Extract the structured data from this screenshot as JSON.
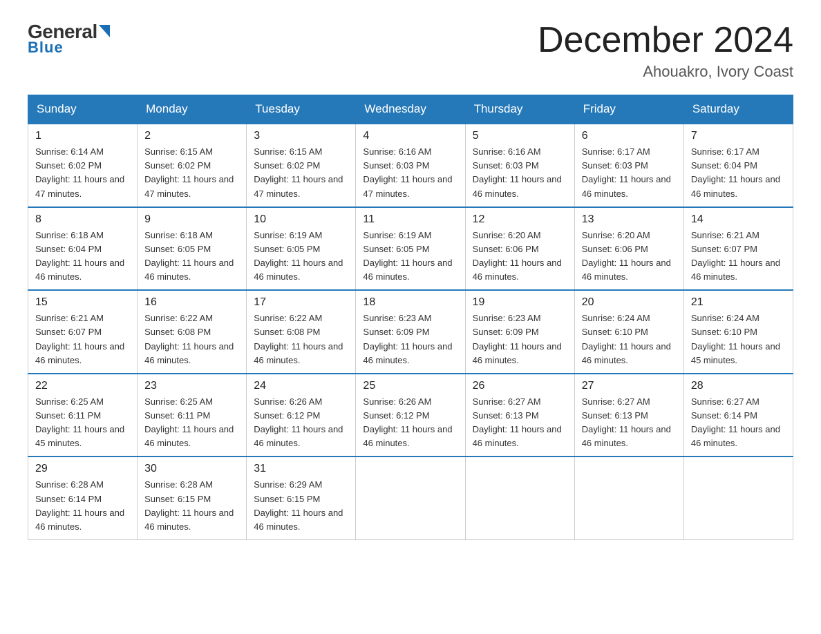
{
  "logo": {
    "general": "General",
    "blue": "Blue",
    "triangle_color": "#1a6eb5"
  },
  "title": "December 2024",
  "subtitle": "Ahouakro, Ivory Coast",
  "weekdays": [
    "Sunday",
    "Monday",
    "Tuesday",
    "Wednesday",
    "Thursday",
    "Friday",
    "Saturday"
  ],
  "weeks": [
    [
      {
        "day": "1",
        "sunrise": "6:14 AM",
        "sunset": "6:02 PM",
        "daylight": "11 hours and 47 minutes."
      },
      {
        "day": "2",
        "sunrise": "6:15 AM",
        "sunset": "6:02 PM",
        "daylight": "11 hours and 47 minutes."
      },
      {
        "day": "3",
        "sunrise": "6:15 AM",
        "sunset": "6:02 PM",
        "daylight": "11 hours and 47 minutes."
      },
      {
        "day": "4",
        "sunrise": "6:16 AM",
        "sunset": "6:03 PM",
        "daylight": "11 hours and 47 minutes."
      },
      {
        "day": "5",
        "sunrise": "6:16 AM",
        "sunset": "6:03 PM",
        "daylight": "11 hours and 46 minutes."
      },
      {
        "day": "6",
        "sunrise": "6:17 AM",
        "sunset": "6:03 PM",
        "daylight": "11 hours and 46 minutes."
      },
      {
        "day": "7",
        "sunrise": "6:17 AM",
        "sunset": "6:04 PM",
        "daylight": "11 hours and 46 minutes."
      }
    ],
    [
      {
        "day": "8",
        "sunrise": "6:18 AM",
        "sunset": "6:04 PM",
        "daylight": "11 hours and 46 minutes."
      },
      {
        "day": "9",
        "sunrise": "6:18 AM",
        "sunset": "6:05 PM",
        "daylight": "11 hours and 46 minutes."
      },
      {
        "day": "10",
        "sunrise": "6:19 AM",
        "sunset": "6:05 PM",
        "daylight": "11 hours and 46 minutes."
      },
      {
        "day": "11",
        "sunrise": "6:19 AM",
        "sunset": "6:05 PM",
        "daylight": "11 hours and 46 minutes."
      },
      {
        "day": "12",
        "sunrise": "6:20 AM",
        "sunset": "6:06 PM",
        "daylight": "11 hours and 46 minutes."
      },
      {
        "day": "13",
        "sunrise": "6:20 AM",
        "sunset": "6:06 PM",
        "daylight": "11 hours and 46 minutes."
      },
      {
        "day": "14",
        "sunrise": "6:21 AM",
        "sunset": "6:07 PM",
        "daylight": "11 hours and 46 minutes."
      }
    ],
    [
      {
        "day": "15",
        "sunrise": "6:21 AM",
        "sunset": "6:07 PM",
        "daylight": "11 hours and 46 minutes."
      },
      {
        "day": "16",
        "sunrise": "6:22 AM",
        "sunset": "6:08 PM",
        "daylight": "11 hours and 46 minutes."
      },
      {
        "day": "17",
        "sunrise": "6:22 AM",
        "sunset": "6:08 PM",
        "daylight": "11 hours and 46 minutes."
      },
      {
        "day": "18",
        "sunrise": "6:23 AM",
        "sunset": "6:09 PM",
        "daylight": "11 hours and 46 minutes."
      },
      {
        "day": "19",
        "sunrise": "6:23 AM",
        "sunset": "6:09 PM",
        "daylight": "11 hours and 46 minutes."
      },
      {
        "day": "20",
        "sunrise": "6:24 AM",
        "sunset": "6:10 PM",
        "daylight": "11 hours and 46 minutes."
      },
      {
        "day": "21",
        "sunrise": "6:24 AM",
        "sunset": "6:10 PM",
        "daylight": "11 hours and 45 minutes."
      }
    ],
    [
      {
        "day": "22",
        "sunrise": "6:25 AM",
        "sunset": "6:11 PM",
        "daylight": "11 hours and 45 minutes."
      },
      {
        "day": "23",
        "sunrise": "6:25 AM",
        "sunset": "6:11 PM",
        "daylight": "11 hours and 46 minutes."
      },
      {
        "day": "24",
        "sunrise": "6:26 AM",
        "sunset": "6:12 PM",
        "daylight": "11 hours and 46 minutes."
      },
      {
        "day": "25",
        "sunrise": "6:26 AM",
        "sunset": "6:12 PM",
        "daylight": "11 hours and 46 minutes."
      },
      {
        "day": "26",
        "sunrise": "6:27 AM",
        "sunset": "6:13 PM",
        "daylight": "11 hours and 46 minutes."
      },
      {
        "day": "27",
        "sunrise": "6:27 AM",
        "sunset": "6:13 PM",
        "daylight": "11 hours and 46 minutes."
      },
      {
        "day": "28",
        "sunrise": "6:27 AM",
        "sunset": "6:14 PM",
        "daylight": "11 hours and 46 minutes."
      }
    ],
    [
      {
        "day": "29",
        "sunrise": "6:28 AM",
        "sunset": "6:14 PM",
        "daylight": "11 hours and 46 minutes."
      },
      {
        "day": "30",
        "sunrise": "6:28 AM",
        "sunset": "6:15 PM",
        "daylight": "11 hours and 46 minutes."
      },
      {
        "day": "31",
        "sunrise": "6:29 AM",
        "sunset": "6:15 PM",
        "daylight": "11 hours and 46 minutes."
      },
      null,
      null,
      null,
      null
    ]
  ]
}
